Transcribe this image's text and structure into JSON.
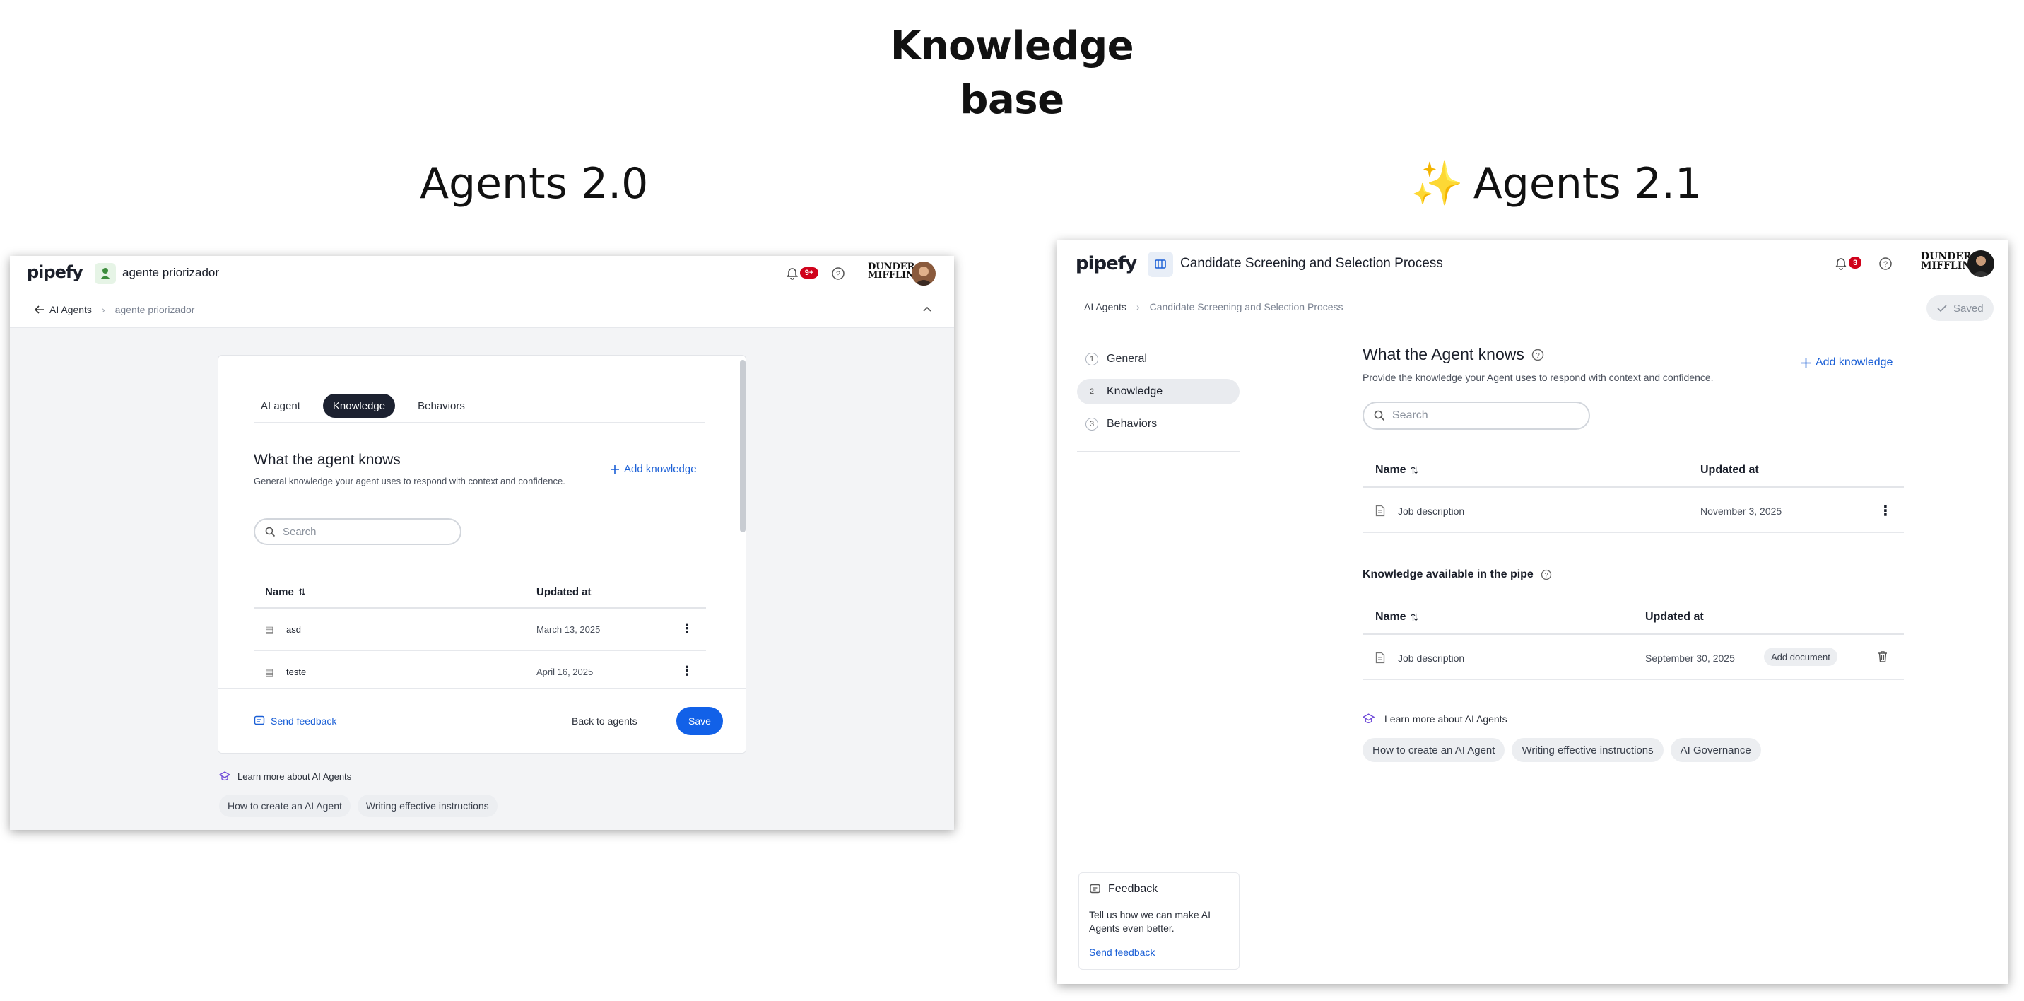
{
  "heading": {
    "line1": "Knowledge",
    "line2": "base"
  },
  "columns": {
    "left_title": "Agents 2.0",
    "right_title": "Agents 2.1",
    "right_emoji": "✨"
  },
  "v20": {
    "logo": "pipefy",
    "agent_name": "agente priorizador",
    "notif_count": "9+",
    "brand_line1": "DUNDER",
    "brand_line2": "MIFFLIN",
    "breadcrumb": {
      "root": "AI Agents",
      "current": "agente priorizador"
    },
    "tabs": [
      "AI agent",
      "Knowledge",
      "Behaviors"
    ],
    "section_title": "What the agent knows",
    "section_subtitle": "General knowledge your agent uses to respond with context and confidence.",
    "add_knowledge": "Add knowledge",
    "search_placeholder": "Search",
    "table": {
      "col_name": "Name",
      "col_updated": "Updated at",
      "rows": [
        {
          "name": "asd",
          "updated": "March 13, 2025"
        },
        {
          "name": "teste",
          "updated": "April 16, 2025"
        }
      ]
    },
    "send_feedback": "Send feedback",
    "back_to_agents": "Back to agents",
    "save": "Save",
    "learn_more": "Learn more about AI Agents",
    "chips": [
      "How to create an AI Agent",
      "Writing effective instructions"
    ]
  },
  "v21": {
    "logo": "pipefy",
    "process_name": "Candidate Screening and Selection Process",
    "notif_count": "3",
    "brand_line1": "DUNDER",
    "brand_line2": "MIFFLIN",
    "breadcrumb": {
      "root": "AI Agents",
      "current": "Candidate Screening and Selection Process"
    },
    "saved": "Saved",
    "steps": [
      {
        "num": "1",
        "label": "General"
      },
      {
        "num": "2",
        "label": "Knowledge"
      },
      {
        "num": "3",
        "label": "Behaviors"
      }
    ],
    "section_title": "What the Agent knows",
    "section_subtitle": "Provide the knowledge your Agent uses to respond with context and confidence.",
    "add_knowledge": "Add knowledge",
    "search_placeholder": "Search",
    "table": {
      "col_name": "Name",
      "col_updated": "Updated at",
      "rows": [
        {
          "name": "Job description",
          "updated": "November 3, 2025"
        }
      ]
    },
    "pipe_section_title": "Knowledge available in the pipe",
    "pipe_table": {
      "col_name": "Name",
      "col_updated": "Updated at",
      "rows": [
        {
          "name": "Job description",
          "updated": "September 30, 2025",
          "action": "Add document"
        }
      ]
    },
    "learn_more": "Learn more about AI Agents",
    "chips": [
      "How to create an AI Agent",
      "Writing effective instructions",
      "AI Governance"
    ],
    "feedback": {
      "title": "Feedback",
      "text": "Tell us how we can make AI Agents even better.",
      "link": "Send feedback"
    }
  }
}
